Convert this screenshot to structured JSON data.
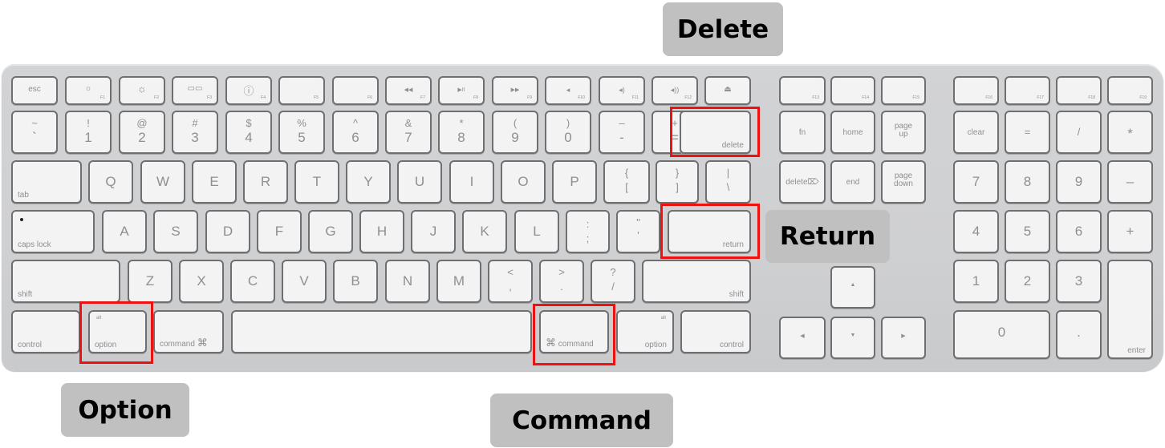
{
  "callouts": {
    "delete": "Delete",
    "return": "Return",
    "option": "Option",
    "command": "Command"
  },
  "highlight_color": "#ee1111",
  "callout_bg": "#c0c0c0",
  "keys": {
    "esc": "esc",
    "f1": {
      "icon": "☼",
      "label": "F1"
    },
    "f2": {
      "icon": "☼",
      "label": "F2"
    },
    "f3": {
      "icon": "▭▭",
      "label": "F3"
    },
    "f4": {
      "icon": "ⓘ",
      "label": "F4"
    },
    "f5": {
      "label": "F5"
    },
    "f6": {
      "label": "F6"
    },
    "f7": {
      "icon": "◀◀",
      "label": "F7"
    },
    "f8": {
      "icon": "▶II",
      "label": "F8"
    },
    "f9": {
      "icon": "▶▶",
      "label": "F9"
    },
    "f10": {
      "icon": "◂",
      "label": "F10"
    },
    "f11": {
      "icon": "◂)",
      "label": "F11"
    },
    "f12": {
      "icon": "◂))",
      "label": "F12"
    },
    "eject": {
      "icon": "⏏"
    },
    "f13": "F13",
    "f14": "F14",
    "f15": "F15",
    "f16": "F16",
    "f17": "F17",
    "f18": "F18",
    "f19": "F19",
    "number_row": [
      {
        "top": "~",
        "bottom": "`"
      },
      {
        "top": "!",
        "bottom": "1"
      },
      {
        "top": "@",
        "bottom": "2"
      },
      {
        "top": "#",
        "bottom": "3"
      },
      {
        "top": "$",
        "bottom": "4"
      },
      {
        "top": "%",
        "bottom": "5"
      },
      {
        "top": "^",
        "bottom": "6"
      },
      {
        "top": "&",
        "bottom": "7"
      },
      {
        "top": "*",
        "bottom": "8"
      },
      {
        "top": "(",
        "bottom": "9"
      },
      {
        "top": ")",
        "bottom": "0"
      },
      {
        "top": "–",
        "bottom": "-"
      },
      {
        "top": "+",
        "bottom": "="
      }
    ],
    "delete": "delete",
    "tab": "tab",
    "qwerty_row": [
      "Q",
      "W",
      "E",
      "R",
      "T",
      "Y",
      "U",
      "I",
      "O",
      "P"
    ],
    "bracket_open": {
      "top": "{",
      "bottom": "["
    },
    "bracket_close": {
      "top": "}",
      "bottom": "]"
    },
    "backslash": {
      "top": "|",
      "bottom": "\\"
    },
    "caps_lock": "caps lock",
    "home_row": [
      "A",
      "S",
      "D",
      "F",
      "G",
      "H",
      "J",
      "K",
      "L"
    ],
    "semicolon": {
      "top": ":",
      "bottom": ";"
    },
    "quote": {
      "top": "\"",
      "bottom": "'"
    },
    "return": "return",
    "shift_left": "shift",
    "bottom_row": [
      "Z",
      "X",
      "C",
      "V",
      "B",
      "N",
      "M"
    ],
    "comma": {
      "top": "<",
      "bottom": ","
    },
    "period": {
      "top": ">",
      "bottom": "."
    },
    "slash": {
      "top": "?",
      "bottom": "/"
    },
    "shift_right": "shift",
    "control_left": "control",
    "option_left": {
      "alt": "alt",
      "label": "option"
    },
    "command_left": {
      "label": "command",
      "symbol": "⌘"
    },
    "command_right": {
      "label": "command",
      "symbol": "⌘"
    },
    "option_right": {
      "alt": "alt",
      "label": "option"
    },
    "control_right": "control",
    "fn": "fn",
    "home": "home",
    "page_up": "page up",
    "forward_delete": "delete",
    "forward_delete_symbol": "⌦",
    "end": "end",
    "page_down": "page down",
    "arrow_up": "▲",
    "arrow_left": "◀",
    "arrow_down": "▼",
    "arrow_right": "▶",
    "numpad": {
      "clear": "clear",
      "equals": "=",
      "divide": "/",
      "multiply": "*",
      "n7": "7",
      "n8": "8",
      "n9": "9",
      "minus": "–",
      "n4": "4",
      "n5": "5",
      "n6": "6",
      "plus": "+",
      "n1": "1",
      "n2": "2",
      "n3": "3",
      "enter": "enter",
      "n0": "0",
      "dot": "."
    }
  }
}
